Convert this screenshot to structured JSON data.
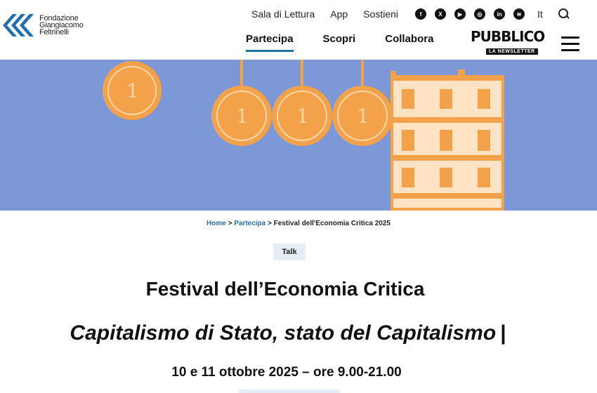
{
  "logo": {
    "line1": "Fondazione",
    "line2": "Giangiacomo",
    "line3": "Feltrinelli"
  },
  "topnav": {
    "items": [
      "Sala di Lettura",
      "App",
      "Sostieni"
    ],
    "lang": "It"
  },
  "social": [
    "facebook-icon",
    "x-icon",
    "youtube-icon",
    "instagram-icon",
    "linkedin-icon",
    "spotify-icon"
  ],
  "mainnav": {
    "items": [
      "Partecipa",
      "Scopri",
      "Collabora"
    ],
    "active": "Partecipa"
  },
  "pubblico": {
    "title": "PUBBLICO",
    "subtitle": "LA NEWSLETTER"
  },
  "breadcrumb": {
    "home": "Home",
    "sep": ">",
    "section": "Partecipa",
    "current": "Festival dell'Economia Critica 2025"
  },
  "event": {
    "tag": "Talk",
    "title": "Festival dell’Economia Critica",
    "subtitle": "Capitalismo di Stato, stato del Capitalismo",
    "subtitle_bar": "|",
    "date": "10 e 11 ottobre 2025 – ore 9.00-21.00"
  },
  "colors": {
    "hero_bg": "#7d98d6",
    "accent": "#1f6f9f",
    "coin": "#f4a24a",
    "tag_bg": "#e6eef5"
  }
}
